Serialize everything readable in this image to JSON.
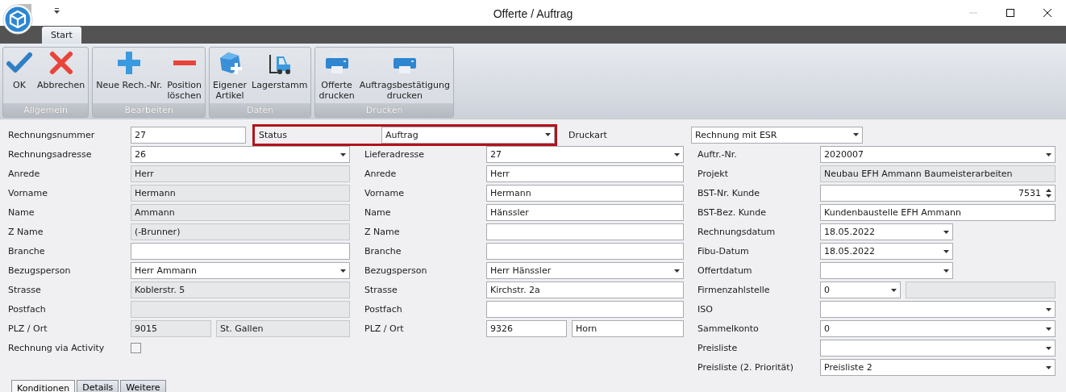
{
  "window": {
    "title": "Offerte / Auftrag"
  },
  "ribbon_tabs": [
    {
      "label": "Start",
      "selected": true
    }
  ],
  "ribbon_groups": [
    {
      "label": "Allgemein",
      "buttons": [
        {
          "label": "OK"
        },
        {
          "label": "Abbrechen"
        }
      ]
    },
    {
      "label": "Bearbeiten",
      "buttons": [
        {
          "label": "Neue Rech.-Nr."
        },
        {
          "label": "Position\nlöschen"
        }
      ]
    },
    {
      "label": "Daten",
      "buttons": [
        {
          "label": "Eigener\nArtikel"
        },
        {
          "label": "Lagerstamm"
        }
      ]
    },
    {
      "label": "Drucken",
      "buttons": [
        {
          "label": "Offerte\ndrucken"
        },
        {
          "label": "Auftragsbestätigung\ndrucken"
        }
      ]
    }
  ],
  "header": {
    "number": {
      "label": "Rechnungsnummer",
      "value": "27"
    },
    "status": {
      "label": "Status",
      "value": "Auftrag",
      "highlighted": true
    },
    "print_type": {
      "label": "Druckart",
      "value": "Rechnung mit ESR"
    }
  },
  "columns": [
    [
      {
        "label": "Rechnungsadresse",
        "kind": "combo",
        "value": "26"
      },
      {
        "label": "Anrede",
        "kind": "readonly",
        "value": "Herr"
      },
      {
        "label": "Vorname",
        "kind": "readonly",
        "value": "Hermann"
      },
      {
        "label": "Name",
        "kind": "readonly",
        "value": "Ammann"
      },
      {
        "label": "Z Name",
        "kind": "readonly",
        "value": "(-Brunner)"
      },
      {
        "label": "Branche",
        "kind": "text"
      },
      {
        "label": "Bezugsperson",
        "kind": "combo",
        "value": "Herr Ammann"
      },
      {
        "label": "Strasse",
        "kind": "readonly",
        "value": "Koblerstr. 5"
      },
      {
        "label": "Postfach",
        "kind": "readonly"
      },
      {
        "label": "PLZ / Ort",
        "kind": "pair",
        "parts": [
          {
            "kind": "readonly",
            "value": "9015"
          },
          {
            "kind": "readonly",
            "value": "St. Gallen"
          }
        ]
      },
      {
        "label": "Rechnung via Activity",
        "kind": "checkbox",
        "checked": false
      }
    ],
    [
      {
        "label": "Lieferadresse",
        "kind": "combo",
        "value": "27"
      },
      {
        "label": "Anrede",
        "kind": "text",
        "value": "Herr"
      },
      {
        "label": "Vorname",
        "kind": "text",
        "value": "Hermann"
      },
      {
        "label": "Name",
        "kind": "text",
        "value": "Hänssler"
      },
      {
        "label": "Z Name",
        "kind": "text"
      },
      {
        "label": "Branche",
        "kind": "text"
      },
      {
        "label": "Bezugsperson",
        "kind": "combo",
        "value": "Herr Hänssler"
      },
      {
        "label": "Strasse",
        "kind": "text",
        "value": "Kirchstr. 2a"
      },
      {
        "label": "Postfach",
        "kind": "text"
      },
      {
        "label": "PLZ / Ort",
        "kind": "pair",
        "parts": [
          {
            "kind": "text",
            "value": "9326"
          },
          {
            "kind": "text",
            "value": "Horn"
          }
        ]
      }
    ],
    [
      {
        "label": "Auftr.-Nr.",
        "kind": "combo",
        "value": "2020007"
      },
      {
        "label": "Projekt",
        "kind": "readonly",
        "value": "Neubau EFH Ammann Baumeisterarbeiten"
      },
      {
        "label": "BST-Nr. Kunde",
        "kind": "spin",
        "value": "7531"
      },
      {
        "label": "BST-Bez. Kunde",
        "kind": "text",
        "value": "Kundenbaustelle EFH Ammann"
      },
      {
        "label": "Rechnungsdatum",
        "kind": "date",
        "value": "18.05.2022"
      },
      {
        "label": "Fibu-Datum",
        "kind": "date",
        "value": "18.05.2022"
      },
      {
        "label": "Offertdatum",
        "kind": "date"
      },
      {
        "label": "Firmenzahlstelle",
        "kind": "pair",
        "parts": [
          {
            "kind": "combo",
            "value": "0"
          },
          {
            "kind": "readonly"
          }
        ]
      },
      {
        "label": "ISO",
        "kind": "combo"
      },
      {
        "label": "Sammelkonto",
        "kind": "combo",
        "value": "0"
      },
      {
        "label": "Preisliste",
        "kind": "combo"
      },
      {
        "label": "Preisliste (2. Priorität)",
        "kind": "combo",
        "value": "Preisliste 2"
      }
    ]
  ],
  "bottom_tabs": [
    {
      "label": "Konditionen",
      "selected": true
    },
    {
      "label": "Details",
      "selected": false
    },
    {
      "label": "Weitere",
      "selected": false
    }
  ]
}
